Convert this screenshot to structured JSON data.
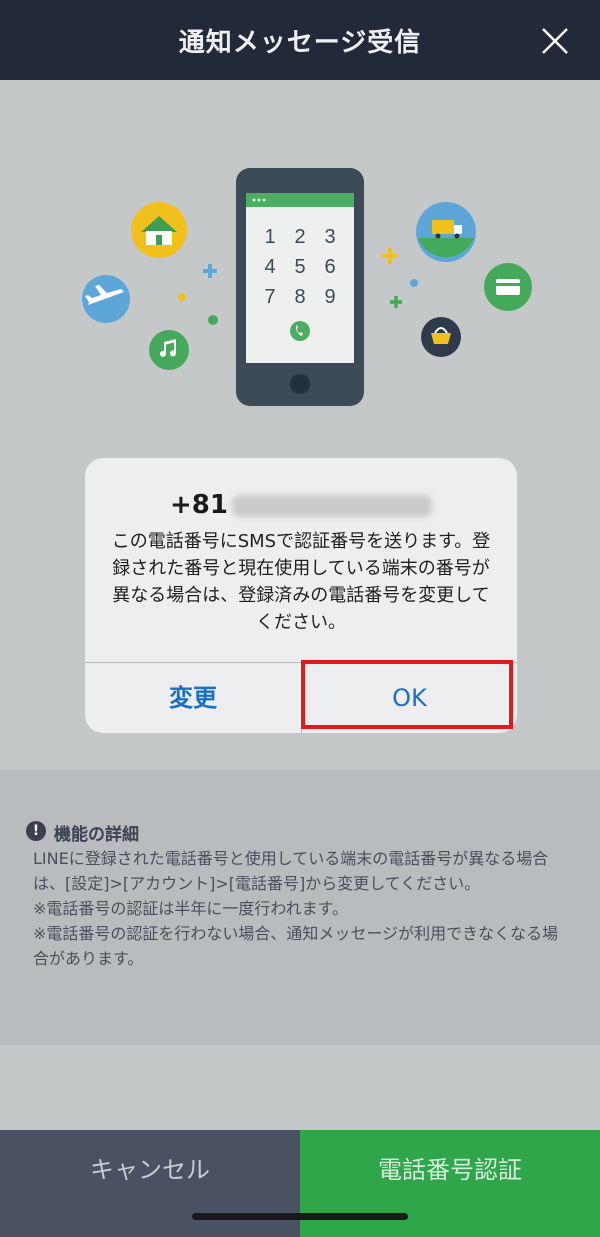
{
  "header": {
    "title": "通知メッセージ受信"
  },
  "dialog": {
    "phone_prefix": "+81",
    "message": "この電話番号にSMSで認証番号を送ります。登録された番号と現在使用している端末の番号が異なる場合は、登録済みの電話番号を変更してください。",
    "change_label": "変更",
    "ok_label": "OK"
  },
  "phone_illustration": {
    "keypad": [
      "1",
      "2",
      "3",
      "4",
      "5",
      "6",
      "7",
      "8",
      "9"
    ]
  },
  "details": {
    "heading": "機能の詳細",
    "body_lines": [
      "LINEに登録された電話番号と使用している端末の電話番号が異なる場合は、[設定]>[アカウント]>[電話番号]から変更してください。",
      "※電話番号の認証は半年に一度行われます。",
      "※電話番号の認証を行わない場合、通知メッセージが利用できなくなる場合があります。"
    ]
  },
  "footer": {
    "cancel_label": "キャンセル",
    "verify_label": "電話番号認証"
  },
  "colors": {
    "header_bg": "#222a3a",
    "link_blue": "#1a6fc6",
    "highlight_red": "#e01a1a",
    "cancel_bg": "#4a5163",
    "verify_bg": "#2fa64a"
  }
}
